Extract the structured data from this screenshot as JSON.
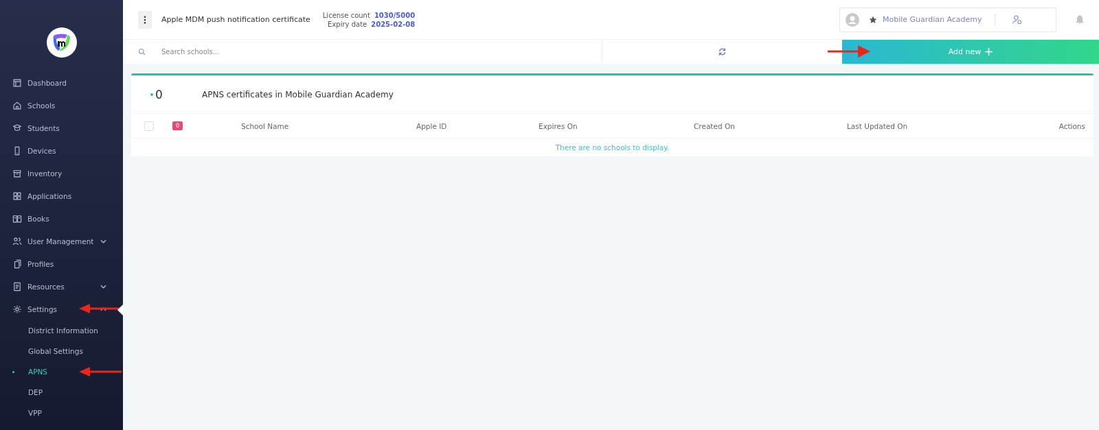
{
  "sidebar": {
    "items": [
      {
        "label": "Dashboard",
        "selected": false
      },
      {
        "label": "Schools",
        "selected": false
      },
      {
        "label": "Students",
        "selected": false
      },
      {
        "label": "Devices",
        "selected": false
      },
      {
        "label": "Inventory",
        "selected": false
      },
      {
        "label": "Applications",
        "selected": false
      },
      {
        "label": "Books",
        "selected": false
      },
      {
        "label": "User Management",
        "selected": false,
        "expanded": false
      },
      {
        "label": "Profiles",
        "selected": false
      },
      {
        "label": "Resources",
        "selected": false,
        "expanded": false
      },
      {
        "label": "Settings",
        "selected": false,
        "expanded": true,
        "children": [
          {
            "label": "District Information",
            "selected": false
          },
          {
            "label": "Global Settings",
            "selected": false
          },
          {
            "label": "APNS",
            "selected": true
          },
          {
            "label": "DEP",
            "selected": false
          },
          {
            "label": "VPP",
            "selected": false
          }
        ]
      }
    ]
  },
  "header": {
    "title": "Apple MDM push notification certificate",
    "license_label": "License count",
    "license_value": "1030/5000",
    "expiry_label": "Expiry date",
    "expiry_value": "2025-02-08",
    "organization": "Mobile Guardian Academy"
  },
  "toolbar": {
    "search": {
      "placeholder": "Search schools..."
    },
    "add_button": "Add new"
  },
  "card": {
    "count": "0",
    "title": "APNS certificates in Mobile Guardian Academy",
    "table": {
      "select_all_checked": false,
      "selected_badge": "0",
      "columns": [
        "School Name",
        "Apple ID",
        "Expires On",
        "Created On",
        "Last Updated On",
        "Actions"
      ],
      "empty_message": "There are no schools to display."
    }
  }
}
